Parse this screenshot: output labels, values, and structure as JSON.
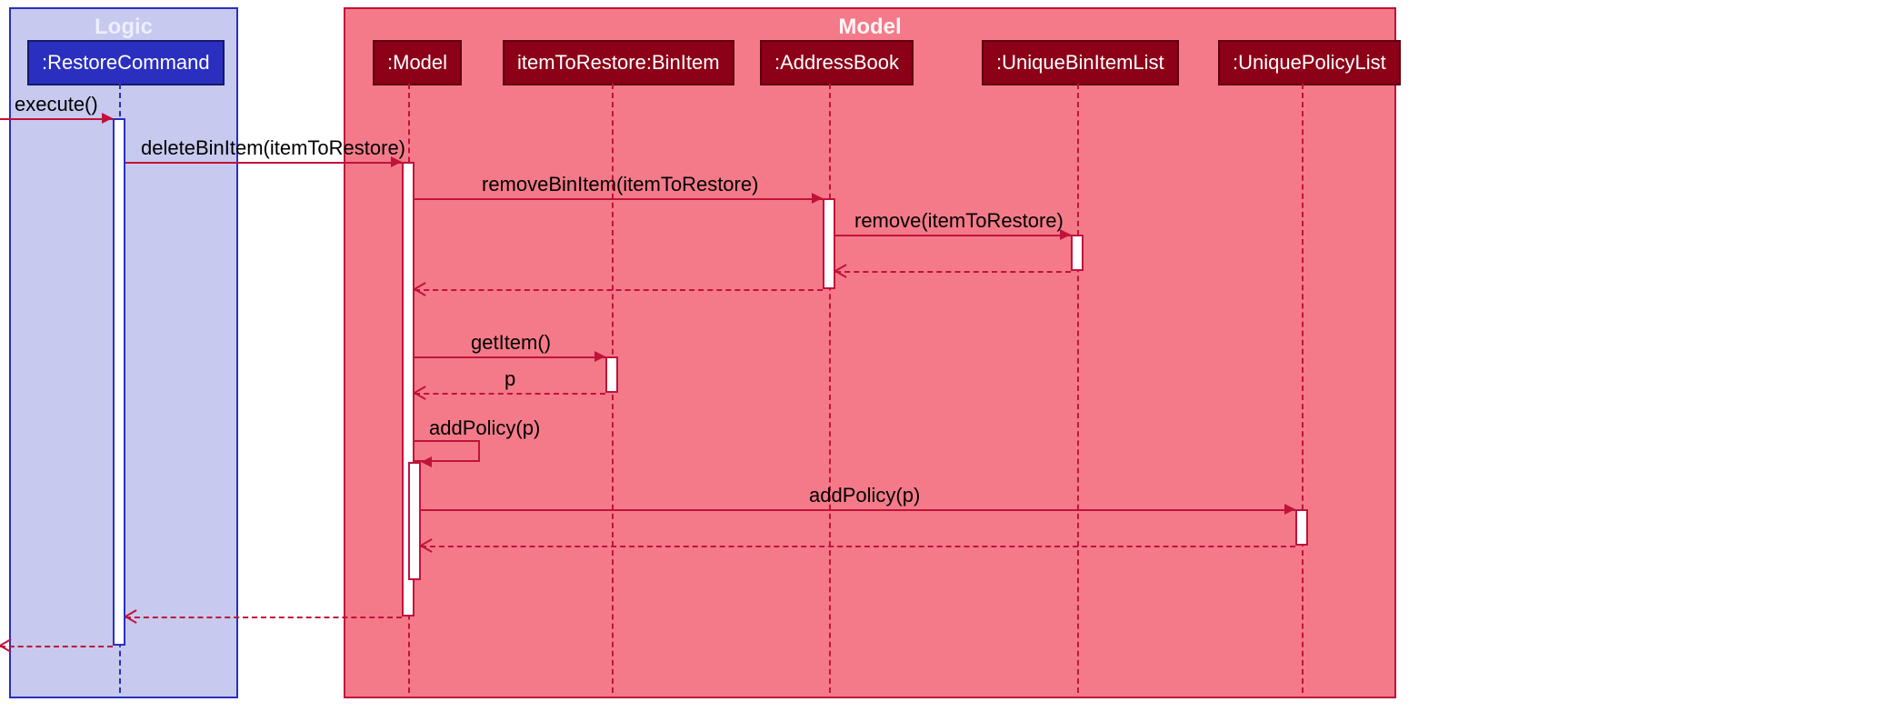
{
  "boxes": {
    "logic_title": "Logic",
    "model_title": "Model"
  },
  "participants": {
    "restore_command": ":RestoreCommand",
    "model": ":Model",
    "item_to_restore": "itemToRestore:BinItem",
    "address_book": ":AddressBook",
    "unique_bin_item_list": ":UniqueBinItemList",
    "unique_policy_list": ":UniquePolicyList"
  },
  "messages": {
    "execute": "execute()",
    "delete_bin_item": "deleteBinItem(itemToRestore)",
    "remove_bin_item": "removeBinItem(itemToRestore)",
    "remove": "remove(itemToRestore)",
    "get_item": "getItem()",
    "p_return": "p",
    "add_policy_self": "addPolicy(p)",
    "add_policy": "addPolicy(p)"
  },
  "colors": {
    "logic_bg": "#c7c9ef",
    "logic_border": "#2a2fbf",
    "model_bg": "#f47a89",
    "model_border": "#c0133a",
    "participant_logic": "#2a2fbf",
    "participant_model": "#8c0018"
  },
  "chart_data": {
    "type": "sequence-diagram",
    "boxes": [
      {
        "name": "Logic",
        "participants": [
          "RestoreCommand"
        ]
      },
      {
        "name": "Model",
        "participants": [
          "Model",
          "itemToRestore:BinItem",
          "AddressBook",
          "UniqueBinItemList",
          "UniquePolicyList"
        ]
      }
    ],
    "participants": [
      ":RestoreCommand",
      ":Model",
      "itemToRestore:BinItem",
      ":AddressBook",
      ":UniqueBinItemList",
      ":UniquePolicyList"
    ],
    "messages": [
      {
        "from": "[",
        "to": ":RestoreCommand",
        "label": "execute()",
        "type": "sync"
      },
      {
        "from": ":RestoreCommand",
        "to": ":Model",
        "label": "deleteBinItem(itemToRestore)",
        "type": "sync"
      },
      {
        "from": ":Model",
        "to": ":AddressBook",
        "label": "removeBinItem(itemToRestore)",
        "type": "sync"
      },
      {
        "from": ":AddressBook",
        "to": ":UniqueBinItemList",
        "label": "remove(itemToRestore)",
        "type": "sync"
      },
      {
        "from": ":UniqueBinItemList",
        "to": ":AddressBook",
        "label": "",
        "type": "return"
      },
      {
        "from": ":AddressBook",
        "to": ":Model",
        "label": "",
        "type": "return"
      },
      {
        "from": ":Model",
        "to": "itemToRestore:BinItem",
        "label": "getItem()",
        "type": "sync"
      },
      {
        "from": "itemToRestore:BinItem",
        "to": ":Model",
        "label": "p",
        "type": "return"
      },
      {
        "from": ":Model",
        "to": ":Model",
        "label": "addPolicy(p)",
        "type": "self"
      },
      {
        "from": ":Model",
        "to": ":UniquePolicyList",
        "label": "addPolicy(p)",
        "type": "sync"
      },
      {
        "from": ":UniquePolicyList",
        "to": ":Model",
        "label": "",
        "type": "return"
      },
      {
        "from": ":Model",
        "to": ":RestoreCommand",
        "label": "",
        "type": "return"
      },
      {
        "from": ":RestoreCommand",
        "to": "[",
        "label": "",
        "type": "return"
      }
    ]
  }
}
